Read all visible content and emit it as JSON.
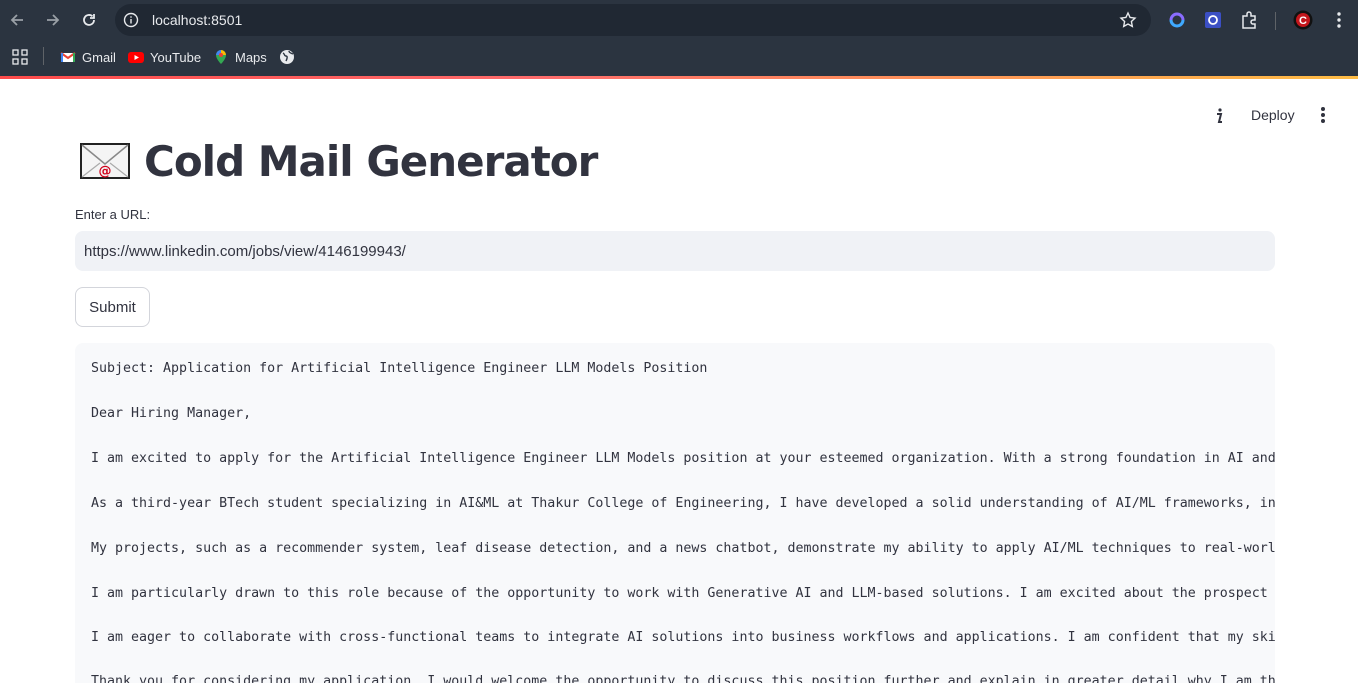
{
  "browser": {
    "url": "localhost:8501",
    "bookmarks": [
      {
        "label": "Gmail",
        "icon": "gmail-icon"
      },
      {
        "label": "YouTube",
        "icon": "youtube-icon"
      },
      {
        "label": "Maps",
        "icon": "maps-icon"
      }
    ],
    "colors": {
      "chrome": "#2b3440",
      "omnibox": "#202833",
      "accent_line": "#ff4b4b"
    }
  },
  "header": {
    "deploy_label": "Deploy"
  },
  "main": {
    "title": "Cold Mail Generator",
    "title_emoji": "envelope-with-at-icon",
    "url_label": "Enter a URL:",
    "url_value": "https://www.linkedin.com/jobs/view/4146199943/",
    "submit_label": "Submit",
    "email_lines": [
      "Subject: Application for Artificial Intelligence Engineer LLM Models Position",
      "Dear Hiring Manager,",
      "I am excited to apply for the Artificial Intelligence Engineer LLM Models position at your esteemed organization. With a strong foundation in AI and",
      "As a third-year BTech student specializing in AI&ML at Thakur College of Engineering, I have developed a solid understanding of AI/ML frameworks, in",
      "My projects, such as a recommender system, leaf disease detection, and a news chatbot, demonstrate my ability to apply AI/ML techniques to real-worl",
      "I am particularly drawn to this role because of the opportunity to work with Generative AI and LLM-based solutions. I am excited about the prospect",
      "I am eager to collaborate with cross-functional teams to integrate AI solutions into business workflows and applications. I am confident that my ski",
      "Thank you for considering my application. I would welcome the opportunity to discuss this position further and explain in greater detail why I am th"
    ]
  }
}
